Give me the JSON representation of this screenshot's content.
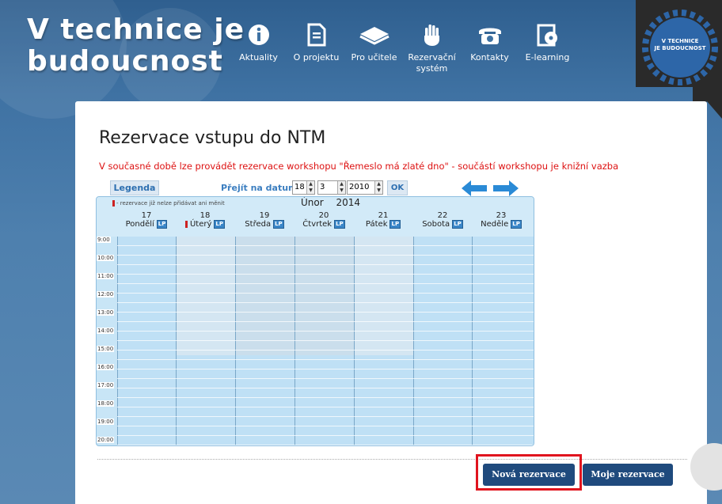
{
  "site": {
    "title_line1": "V technice je",
    "title_line2": "budoucnost",
    "badge_line1": "V TECHNICE",
    "badge_line2": "JE BUDOUCNOST"
  },
  "nav": [
    {
      "label": "Aktuality",
      "icon": "info-icon"
    },
    {
      "label": "O projektu",
      "icon": "document-icon"
    },
    {
      "label": "Pro učitele",
      "icon": "book-icon"
    },
    {
      "label": "Rezervační\nsystém",
      "icon": "hand-icon"
    },
    {
      "label": "Kontakty",
      "icon": "phone-icon"
    },
    {
      "label": "E-learning",
      "icon": "disc-icon"
    }
  ],
  "page": {
    "title": "Rezervace vstupu do NTM",
    "notice": "V současné době lze provádět rezervace workshopu \"Řemeslo má zlaté dno\" - součástí workshopu je knižní vazba"
  },
  "toolbar": {
    "legend_label": "Legenda",
    "goto_label": "Přejít na datum:",
    "day": "18",
    "month": "3",
    "year": "2010",
    "ok_label": "OK"
  },
  "calendar": {
    "restriction_note": "- rezervace již nelze přidávat ani měnit",
    "month_label": "Únor",
    "year_label": "2014",
    "lp_label": "LP",
    "days": [
      {
        "num": "17",
        "name": "Pondělí",
        "flag": false
      },
      {
        "num": "18",
        "name": "Úterý",
        "flag": true
      },
      {
        "num": "19",
        "name": "Středa",
        "flag": false
      },
      {
        "num": "20",
        "name": "Čtvrtek",
        "flag": false
      },
      {
        "num": "21",
        "name": "Pátek",
        "flag": false
      },
      {
        "num": "22",
        "name": "Sobota",
        "flag": false
      },
      {
        "num": "23",
        "name": "Neděle",
        "flag": false
      }
    ],
    "times": [
      "9:00",
      "10:00",
      "11:00",
      "12:00",
      "13:00",
      "14:00",
      "15:00",
      "16:00",
      "17:00",
      "18:00",
      "19:00",
      "20:00"
    ]
  },
  "actions": {
    "new_reservation": "Nová rezervace",
    "my_reservations": "Moje rezervace"
  },
  "colors": {
    "accent": "#1f4a7d",
    "notice": "#dd1111",
    "highlight": "#e0141e"
  }
}
